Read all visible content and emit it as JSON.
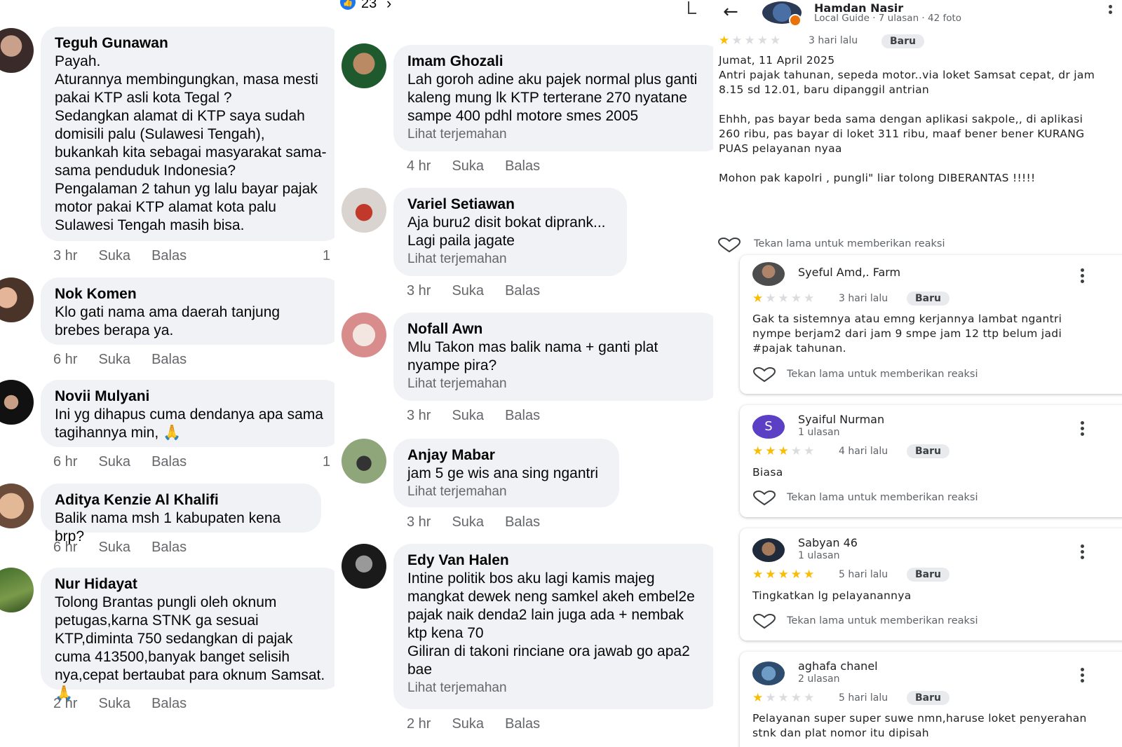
{
  "panel1": {
    "comments": [
      {
        "name": "Teguh Gunawan",
        "text": "Payah.\nAturannya membingungkan, masa mesti pakai KTP asli kota Tegal ?\nSedangkan alamat di KTP saya sudah domisili palu (Sulawesi Tengah), bukankah kita sebagai masyarakat sama-sama penduduk Indonesia?\nPengalaman 2 tahun yg lalu bayar pajak motor pakai KTP alamat kota palu Sulawesi Tengah masih bisa.",
        "time": "3 hr",
        "like": "Suka",
        "reply": "Balas",
        "count": "1"
      },
      {
        "name": "Nok Komen",
        "text": "Klo gati nama ama daerah tanjung brebes berapa ya.",
        "time": "6 hr",
        "like": "Suka",
        "reply": "Balas"
      },
      {
        "name": "Novii Mulyani",
        "text": "Ini yg dihapus cuma dendanya apa sama tagihannya min, 🙏",
        "time": "6 hr",
        "like": "Suka",
        "reply": "Balas",
        "count": "1"
      },
      {
        "name": "Aditya Kenzie Al Khalifi",
        "text": "Balik nama msh 1 kabupaten kena brp?",
        "time": "6 hr",
        "like": "Suka",
        "reply": "Balas"
      },
      {
        "name": "Nur Hidayat",
        "text": "Tolong Brantas pungli oleh oknum petugas,karna STNK ga sesuai KTP,diminta 750 sedangkan di pajak cuma 413500,banyak banget selisih nya,cepat bertaubat para oknum Samsat.🙏",
        "time": "2 hr",
        "like": "Suka",
        "reply": "Balas"
      }
    ]
  },
  "panel2": {
    "top_count": "23",
    "comments": [
      {
        "name": "Imam Ghozali",
        "text": "Lah goroh adine aku pajek normal plus ganti kaleng mung lk KTP terterane 270 nyatane sampe 400 pdhl motore smes 2005",
        "trans": "Lihat terjemahan",
        "time": "4 hr",
        "like": "Suka",
        "reply": "Balas"
      },
      {
        "name": "Variel Setiawan",
        "text": "Aja buru2 disit bokat diprank...\nLagi paila jagate",
        "trans": "Lihat terjemahan",
        "time": "3 hr",
        "like": "Suka",
        "reply": "Balas"
      },
      {
        "name": "Nofall Awn",
        "text": "Mlu Takon mas balik nama + ganti plat nyampe pira?",
        "trans": "Lihat terjemahan",
        "time": "3 hr",
        "like": "Suka",
        "reply": "Balas"
      },
      {
        "name": "Anjay Mabar",
        "text": "jam 5 ge wis ana sing ngantri",
        "trans": "Lihat terjemahan",
        "time": "3 hr",
        "like": "Suka",
        "reply": "Balas"
      },
      {
        "name": "Edy Van Halen",
        "text": "Intine politik bos aku lagi kamis majeg mangkat dewek neng samkel akeh embel2e pajak naik denda2 lain juga ada + nembak ktp kena 70\nGiliran di takoni rinciane ora jawab go apa2 bae",
        "trans": "Lihat terjemahan",
        "time": "2 hr",
        "like": "Suka",
        "reply": "Balas"
      }
    ]
  },
  "panel3": {
    "header": {
      "name": "Hamdan Nasir",
      "sub": "Local Guide · 7 ulasan · 42 foto"
    },
    "main_review": {
      "stars": 1,
      "date": "3 hari lalu",
      "badge": "Baru",
      "text": "Jumat, 11 April 2025\nAntri pajak tahunan, sepeda motor..via loket Samsat cepat, dr jam 8.15 sd 12.01, baru dipanggil antrian\n\nEhhh, pas bayar beda sama dengan aplikasi sakpole,, di aplikasi 260 ribu, pas bayar di loket 311 ribu, maaf bener bener KURANG PUAS pelayanan nyaa\n\nMohon pak kapolri , pungli\" liar tolong DIBERANTAS !!!!!",
      "react": "Tekan lama untuk memberikan reaksi"
    },
    "reviews": [
      {
        "name": "Syeful Amd,. Farm",
        "sub": "",
        "stars": 1,
        "date": "3 hari lalu",
        "badge": "Baru",
        "text": "Gak ta sistemnya atau emng kerjannya lambat ngantri nympe berjam2 dari jam 9 smpe jam 12 ttp belum jadi #pajak tahunan.",
        "react": "Tekan lama untuk memberikan reaksi"
      },
      {
        "name": "Syaiful Nurman",
        "sub": "1 ulasan",
        "initial": "S",
        "stars": 3,
        "date": "4 hari lalu",
        "badge": "Baru",
        "text": "Biasa",
        "react": "Tekan lama untuk memberikan reaksi"
      },
      {
        "name": "Sabyan 46",
        "sub": "1 ulasan",
        "stars": 5,
        "date": "5 hari lalu",
        "badge": "Baru",
        "text": "Tingkatkan lg pelayanannya",
        "react": "Tekan lama untuk memberikan reaksi"
      },
      {
        "name": "aghafa chanel",
        "sub": "2 ulasan",
        "stars": 1,
        "date": "5 hari lalu",
        "badge": "Baru",
        "text": "Pelayanan super super suwe nmn,haruse loket penyerahan stnk dan plat nomor itu dipisah",
        "react": ""
      }
    ]
  },
  "colors": {
    "bubble": "#f0f2f5",
    "fb_gray": "#65676b",
    "star": "#fbbc04",
    "star_off": "#dadce0",
    "fb_blue": "#1877f2",
    "avatar_purple": "#5b3fc4"
  }
}
